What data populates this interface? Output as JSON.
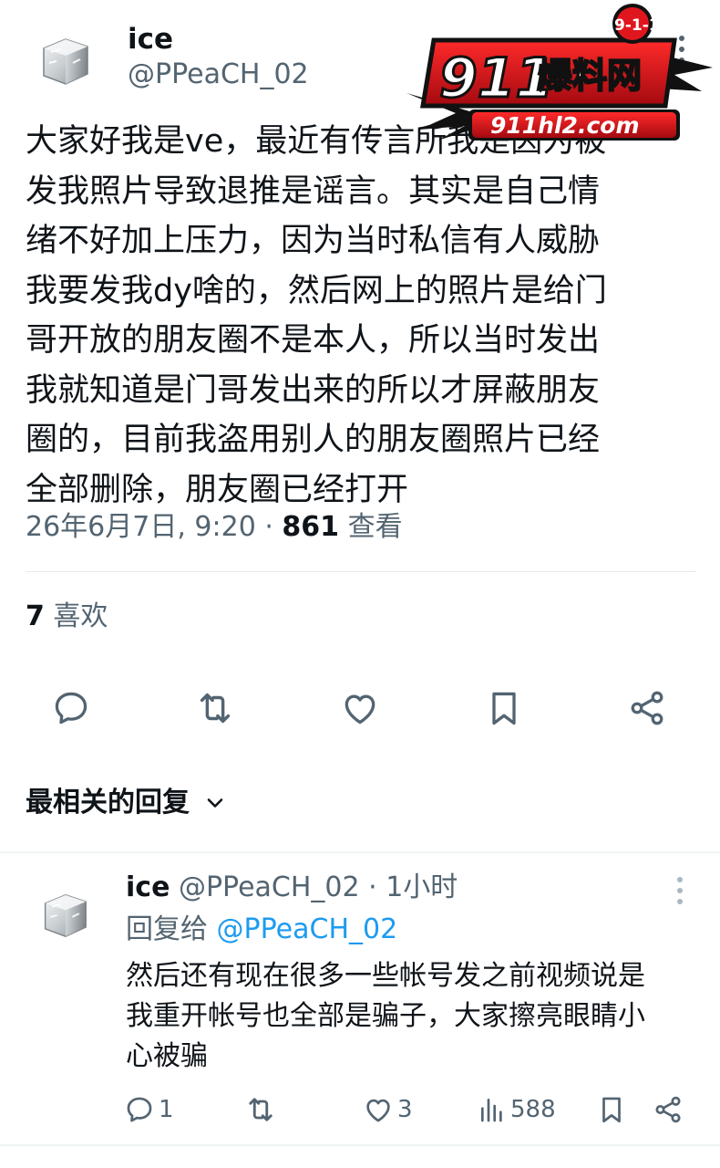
{
  "tweet": {
    "author": {
      "display_name": "ice",
      "handle": "@PPeaCH_02",
      "avatar": "ice-cube-avatar"
    },
    "text_lines": [
      "大家好我是ve，最近有传言所我是因为被",
      "发我照片导致退推是谣言。其实是自己情",
      "绪不好加上压力，因为当时私信有人威胁",
      "我要发我dy啥的，然后网上的照片是给门",
      "哥开放的朋友圈不是本人，所以当时发出",
      "我就知道是门哥发出来的所以才屏蔽朋友",
      "圈的，目前我盗用别人的朋友圈照片已经",
      "全部删除，朋友圈已经打开"
    ],
    "timestamp": "26年6月7日, 9:20",
    "separator": " · ",
    "views_count": "861",
    "views_label": " 查看",
    "likes_count": "7",
    "likes_label": " 喜欢",
    "actions": {
      "reply_icon": "comment-icon",
      "retweet_icon": "retweet-icon",
      "like_icon": "heart-icon",
      "bookmark_icon": "bookmark-icon",
      "share_icon": "share-icon"
    }
  },
  "watermark": {
    "badge": "9-1-1",
    "number": "911",
    "chinese": "爆料网",
    "url": "911hl2.com"
  },
  "replies": {
    "sort_label": "最相关的回复",
    "items": [
      {
        "display_name": "ice",
        "handle": "@PPeaCH_02",
        "time_sep": " · ",
        "time": "1小时",
        "replying_to_label": "回复给 ",
        "replying_to_handle": "@PPeaCH_02",
        "text_lines": [
          "然后还有现在很多一些帐号发之前视频说是",
          "我重开帐号也全部是骗子，大家擦亮眼睛小",
          "心被骗"
        ],
        "reply_count": "1",
        "retweet_count": "",
        "like_count": "3",
        "view_count": "588"
      }
    ]
  },
  "colors": {
    "text_primary": "#0f1419",
    "text_secondary": "#536471",
    "link": "#1d9bf0",
    "divider": "#eff3f4",
    "watermark_red": "#e0161e"
  }
}
